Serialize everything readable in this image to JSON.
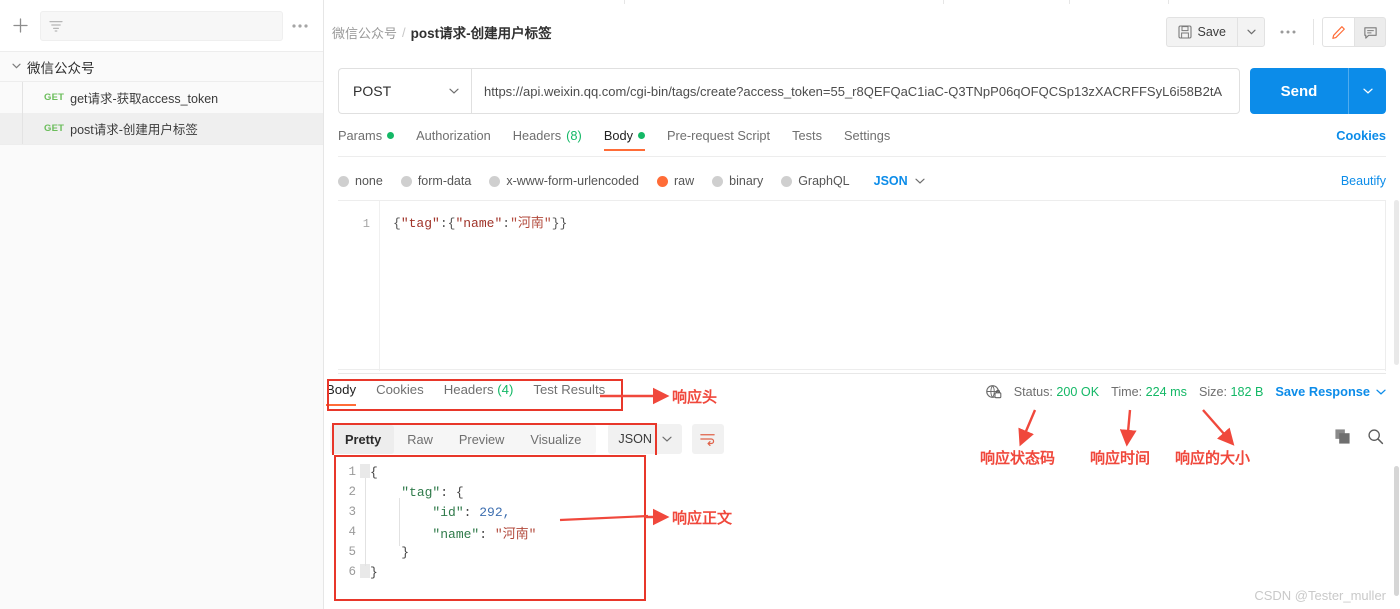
{
  "sidebar": {
    "new_label": "+",
    "filter_placeholder": "",
    "more_label": "000",
    "collection": {
      "name": "微信公众号",
      "expanded": true
    },
    "requests": [
      {
        "method": "GET",
        "name": "get请求-获取access_token",
        "active": false
      },
      {
        "method": "GET",
        "name": "post请求-创建用户标签",
        "active": true
      }
    ]
  },
  "header": {
    "breadcrumb_collection": "微信公众号",
    "breadcrumb_sep": "/",
    "breadcrumb_request": "post请求-创建用户标签",
    "save_label": "Save",
    "save_caret": "⌄",
    "more_label": "000"
  },
  "request": {
    "method": "POST",
    "method_caret": "⌄",
    "url": "https://api.weixin.qq.com/cgi-bin/tags/create?access_token=55_r8QEFQaC1iaC-Q3TNpP06qOFQCSp13zXACRFFSyL6i58B2tA",
    "send_label": "Send",
    "send_caret": "⌄",
    "tabs": [
      {
        "label": "Params",
        "dot": true,
        "count": "",
        "active": false
      },
      {
        "label": "Authorization",
        "dot": false,
        "count": "",
        "active": false
      },
      {
        "label": "Headers",
        "dot": false,
        "count": "(8)",
        "active": false
      },
      {
        "label": "Body",
        "dot": true,
        "count": "",
        "active": true
      },
      {
        "label": "Pre-request Script",
        "dot": false,
        "count": "",
        "active": false
      },
      {
        "label": "Tests",
        "dot": false,
        "count": "",
        "active": false
      },
      {
        "label": "Settings",
        "dot": false,
        "count": "",
        "active": false
      }
    ],
    "cookies_link": "Cookies",
    "body_types": [
      {
        "label": "none",
        "selected": false
      },
      {
        "label": "form-data",
        "selected": false
      },
      {
        "label": "x-www-form-urlencoded",
        "selected": false
      },
      {
        "label": "raw",
        "selected": true
      },
      {
        "label": "binary",
        "selected": false
      },
      {
        "label": "GraphQL",
        "selected": false
      }
    ],
    "body_format": "JSON",
    "body_format_caret": "⌄",
    "beautify_label": "Beautify",
    "body_editor": {
      "line_number": "1",
      "open1": "{",
      "key_tag": "\"tag\"",
      "colon1": ":",
      "open2": "{",
      "key_name": "\"name\"",
      "colon2": ":",
      "value_name": "\"河南\"",
      "close": "}}"
    }
  },
  "response": {
    "tabs": [
      {
        "label": "Body",
        "count": "",
        "active": true
      },
      {
        "label": "Cookies",
        "count": "",
        "active": false
      },
      {
        "label": "Headers",
        "count": "(4)",
        "active": false
      },
      {
        "label": "Test Results",
        "count": "",
        "active": false
      }
    ],
    "status_label": "Status:",
    "status_value": "200 OK",
    "time_label": "Time:",
    "time_value": "224 ms",
    "size_label": "Size:",
    "size_value": "182 B",
    "save_response_label": "Save Response",
    "save_response_caret": "⌄",
    "view_tabs": [
      {
        "label": "Pretty",
        "active": true
      },
      {
        "label": "Raw",
        "active": false
      },
      {
        "label": "Preview",
        "active": false
      },
      {
        "label": "Visualize",
        "active": false
      }
    ],
    "format": "JSON",
    "format_caret": "⌄",
    "body_lines": [
      {
        "n": "1",
        "parts": [
          {
            "t": "brace",
            "v": "{"
          }
        ]
      },
      {
        "n": "2",
        "parts": [
          {
            "t": "plain",
            "v": "    "
          },
          {
            "t": "key",
            "v": "\"tag\""
          },
          {
            "t": "colon",
            "v": ": "
          },
          {
            "t": "brace",
            "v": "{"
          }
        ]
      },
      {
        "n": "3",
        "parts": [
          {
            "t": "plain",
            "v": "        "
          },
          {
            "t": "key",
            "v": "\"id\""
          },
          {
            "t": "colon",
            "v": ": "
          },
          {
            "t": "num",
            "v": "292,"
          }
        ]
      },
      {
        "n": "4",
        "parts": [
          {
            "t": "plain",
            "v": "        "
          },
          {
            "t": "key",
            "v": "\"name\""
          },
          {
            "t": "colon",
            "v": ": "
          },
          {
            "t": "str",
            "v": "\"河南\""
          }
        ]
      },
      {
        "n": "5",
        "parts": [
          {
            "t": "plain",
            "v": "    "
          },
          {
            "t": "brace",
            "v": "}"
          }
        ]
      },
      {
        "n": "6",
        "parts": [
          {
            "t": "brace",
            "v": "}"
          }
        ]
      }
    ]
  },
  "annotations": [
    {
      "id": "resp-header",
      "text": "响应头"
    },
    {
      "id": "resp-status",
      "text": "响应状态码"
    },
    {
      "id": "resp-time",
      "text": "响应时间"
    },
    {
      "id": "resp-size",
      "text": "响应的大小"
    },
    {
      "id": "resp-body",
      "text": "响应正文"
    }
  ],
  "watermark": "CSDN @Tester_muller",
  "colors": {
    "accent_orange": "#ff6c37",
    "brand_blue": "#0c8ce9",
    "success_green": "#14b866",
    "annotation_red": "#f0483c"
  }
}
